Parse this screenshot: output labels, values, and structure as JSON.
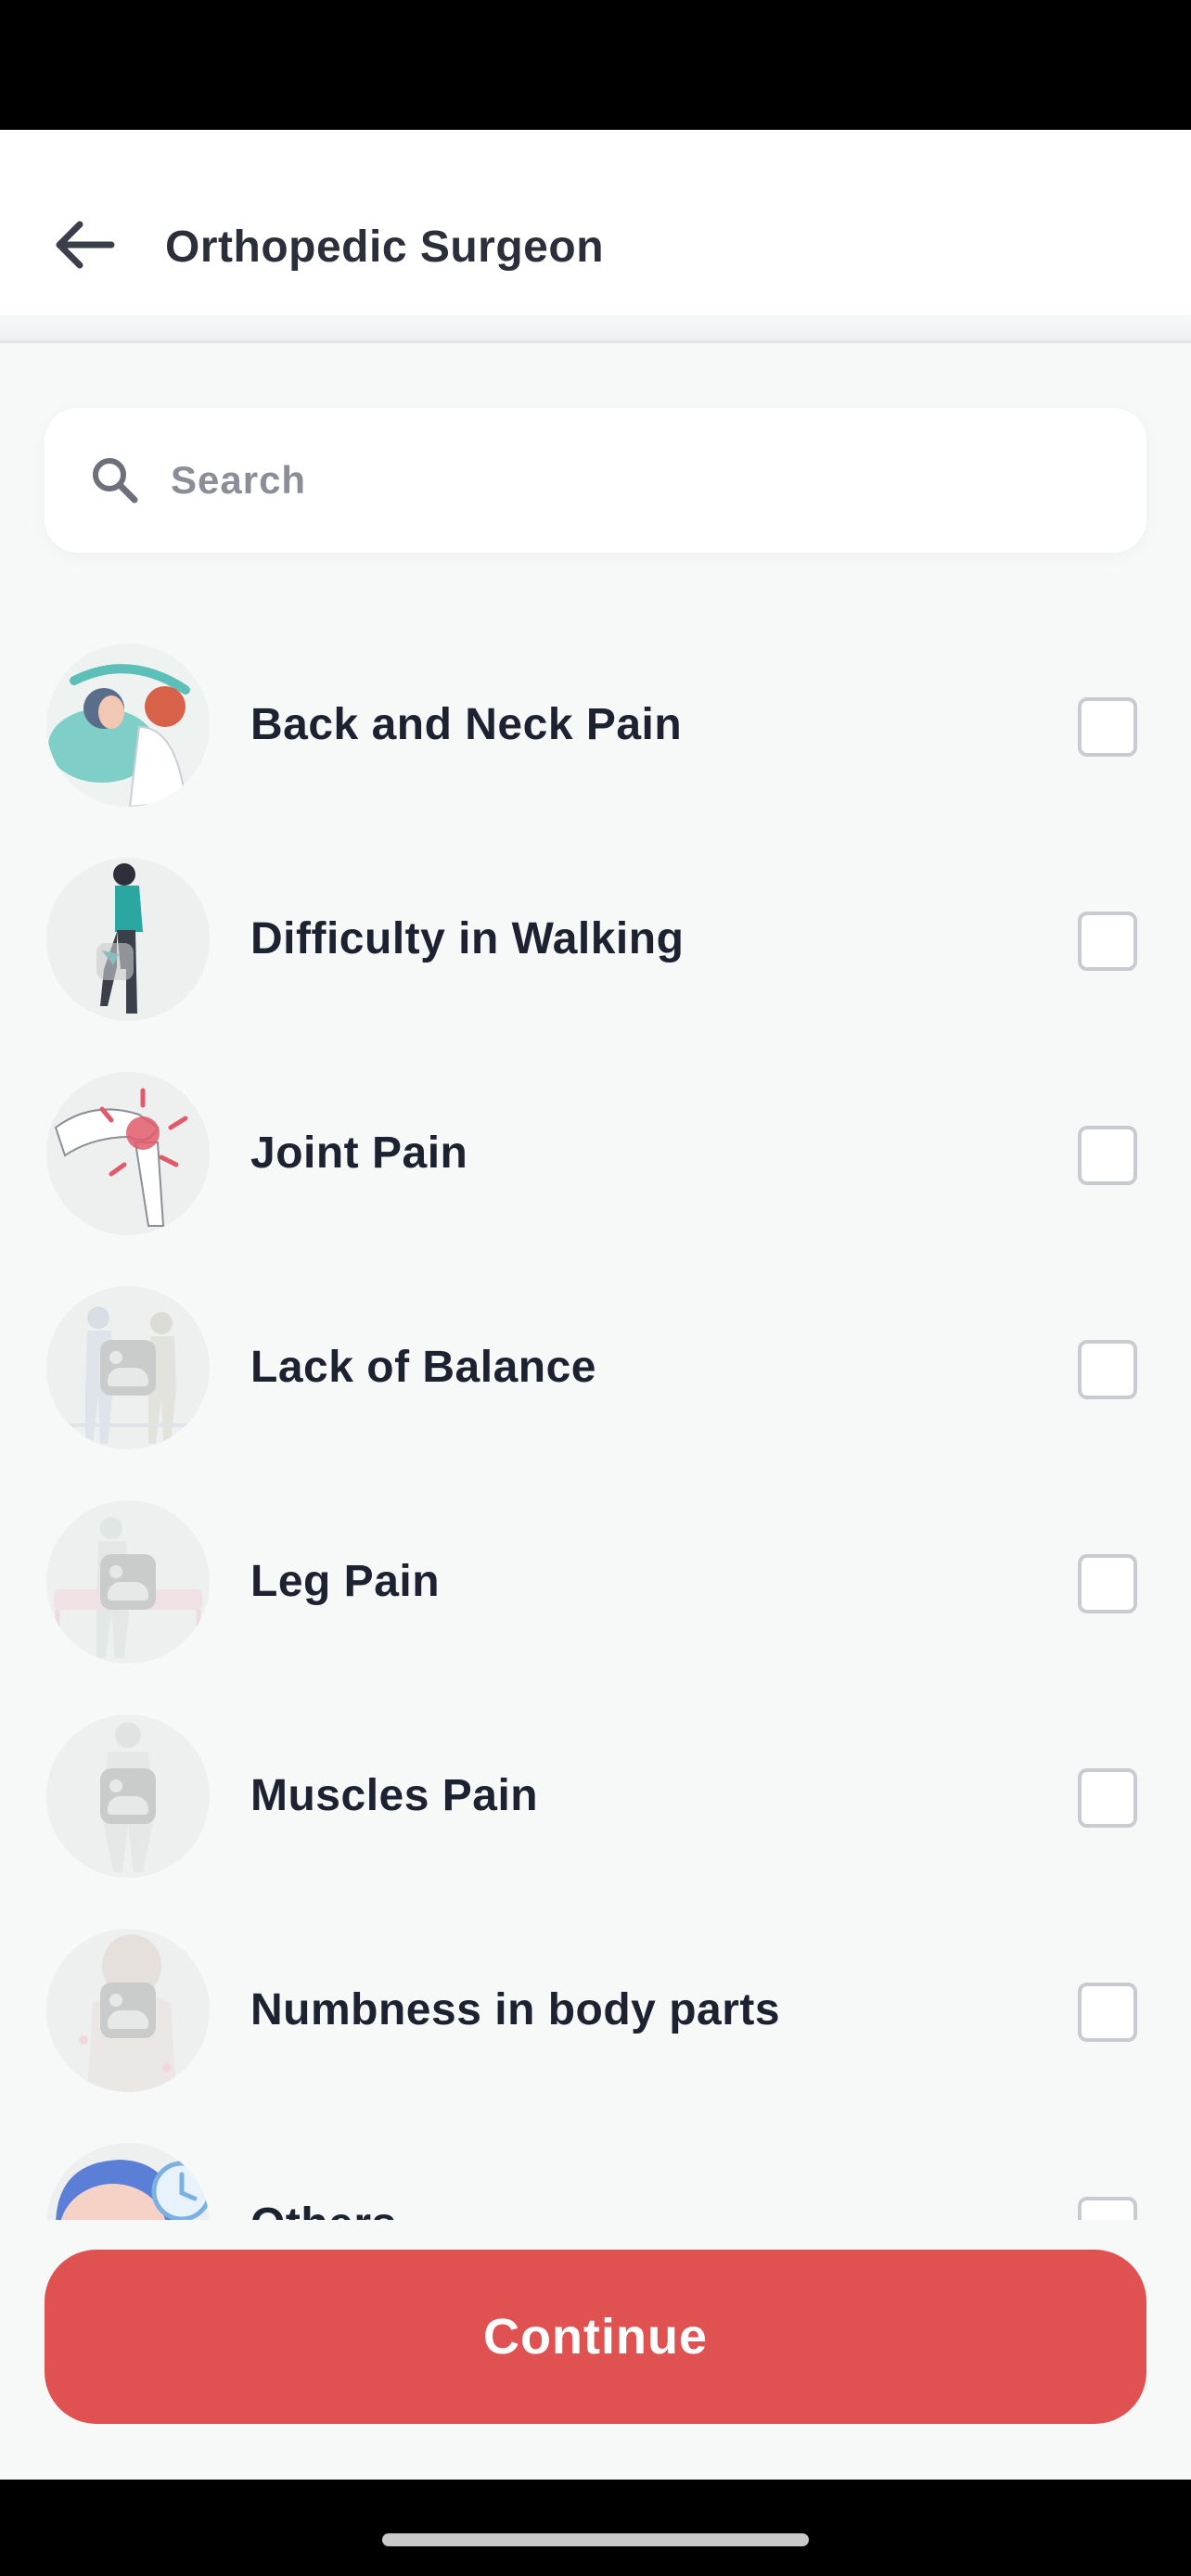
{
  "header": {
    "title": "Orthopedic Surgeon",
    "back_icon": "arrow-left-icon"
  },
  "search": {
    "placeholder": "Search",
    "icon": "search-icon"
  },
  "symptoms": [
    {
      "label": "Back and Neck Pain",
      "checked": false,
      "image": "back-neck-illustration"
    },
    {
      "label": "Difficulty in Walking",
      "checked": false,
      "image": "walking-illustration"
    },
    {
      "label": "Joint Pain",
      "checked": false,
      "image": "joint-illustration"
    },
    {
      "label": "Lack of Balance",
      "checked": false,
      "image": "image-placeholder"
    },
    {
      "label": "Leg Pain",
      "checked": false,
      "image": "image-placeholder"
    },
    {
      "label": "Muscles Pain",
      "checked": false,
      "image": "image-placeholder"
    },
    {
      "label": "Numbness in body parts",
      "checked": false,
      "image": "image-placeholder"
    },
    {
      "label": "Others",
      "checked": false,
      "image": "doctor-illustration"
    }
  ],
  "footer": {
    "continue_label": "Continue"
  },
  "colors": {
    "accent": "#e05252",
    "background": "#f7f8f8",
    "text": "#1c2230"
  }
}
